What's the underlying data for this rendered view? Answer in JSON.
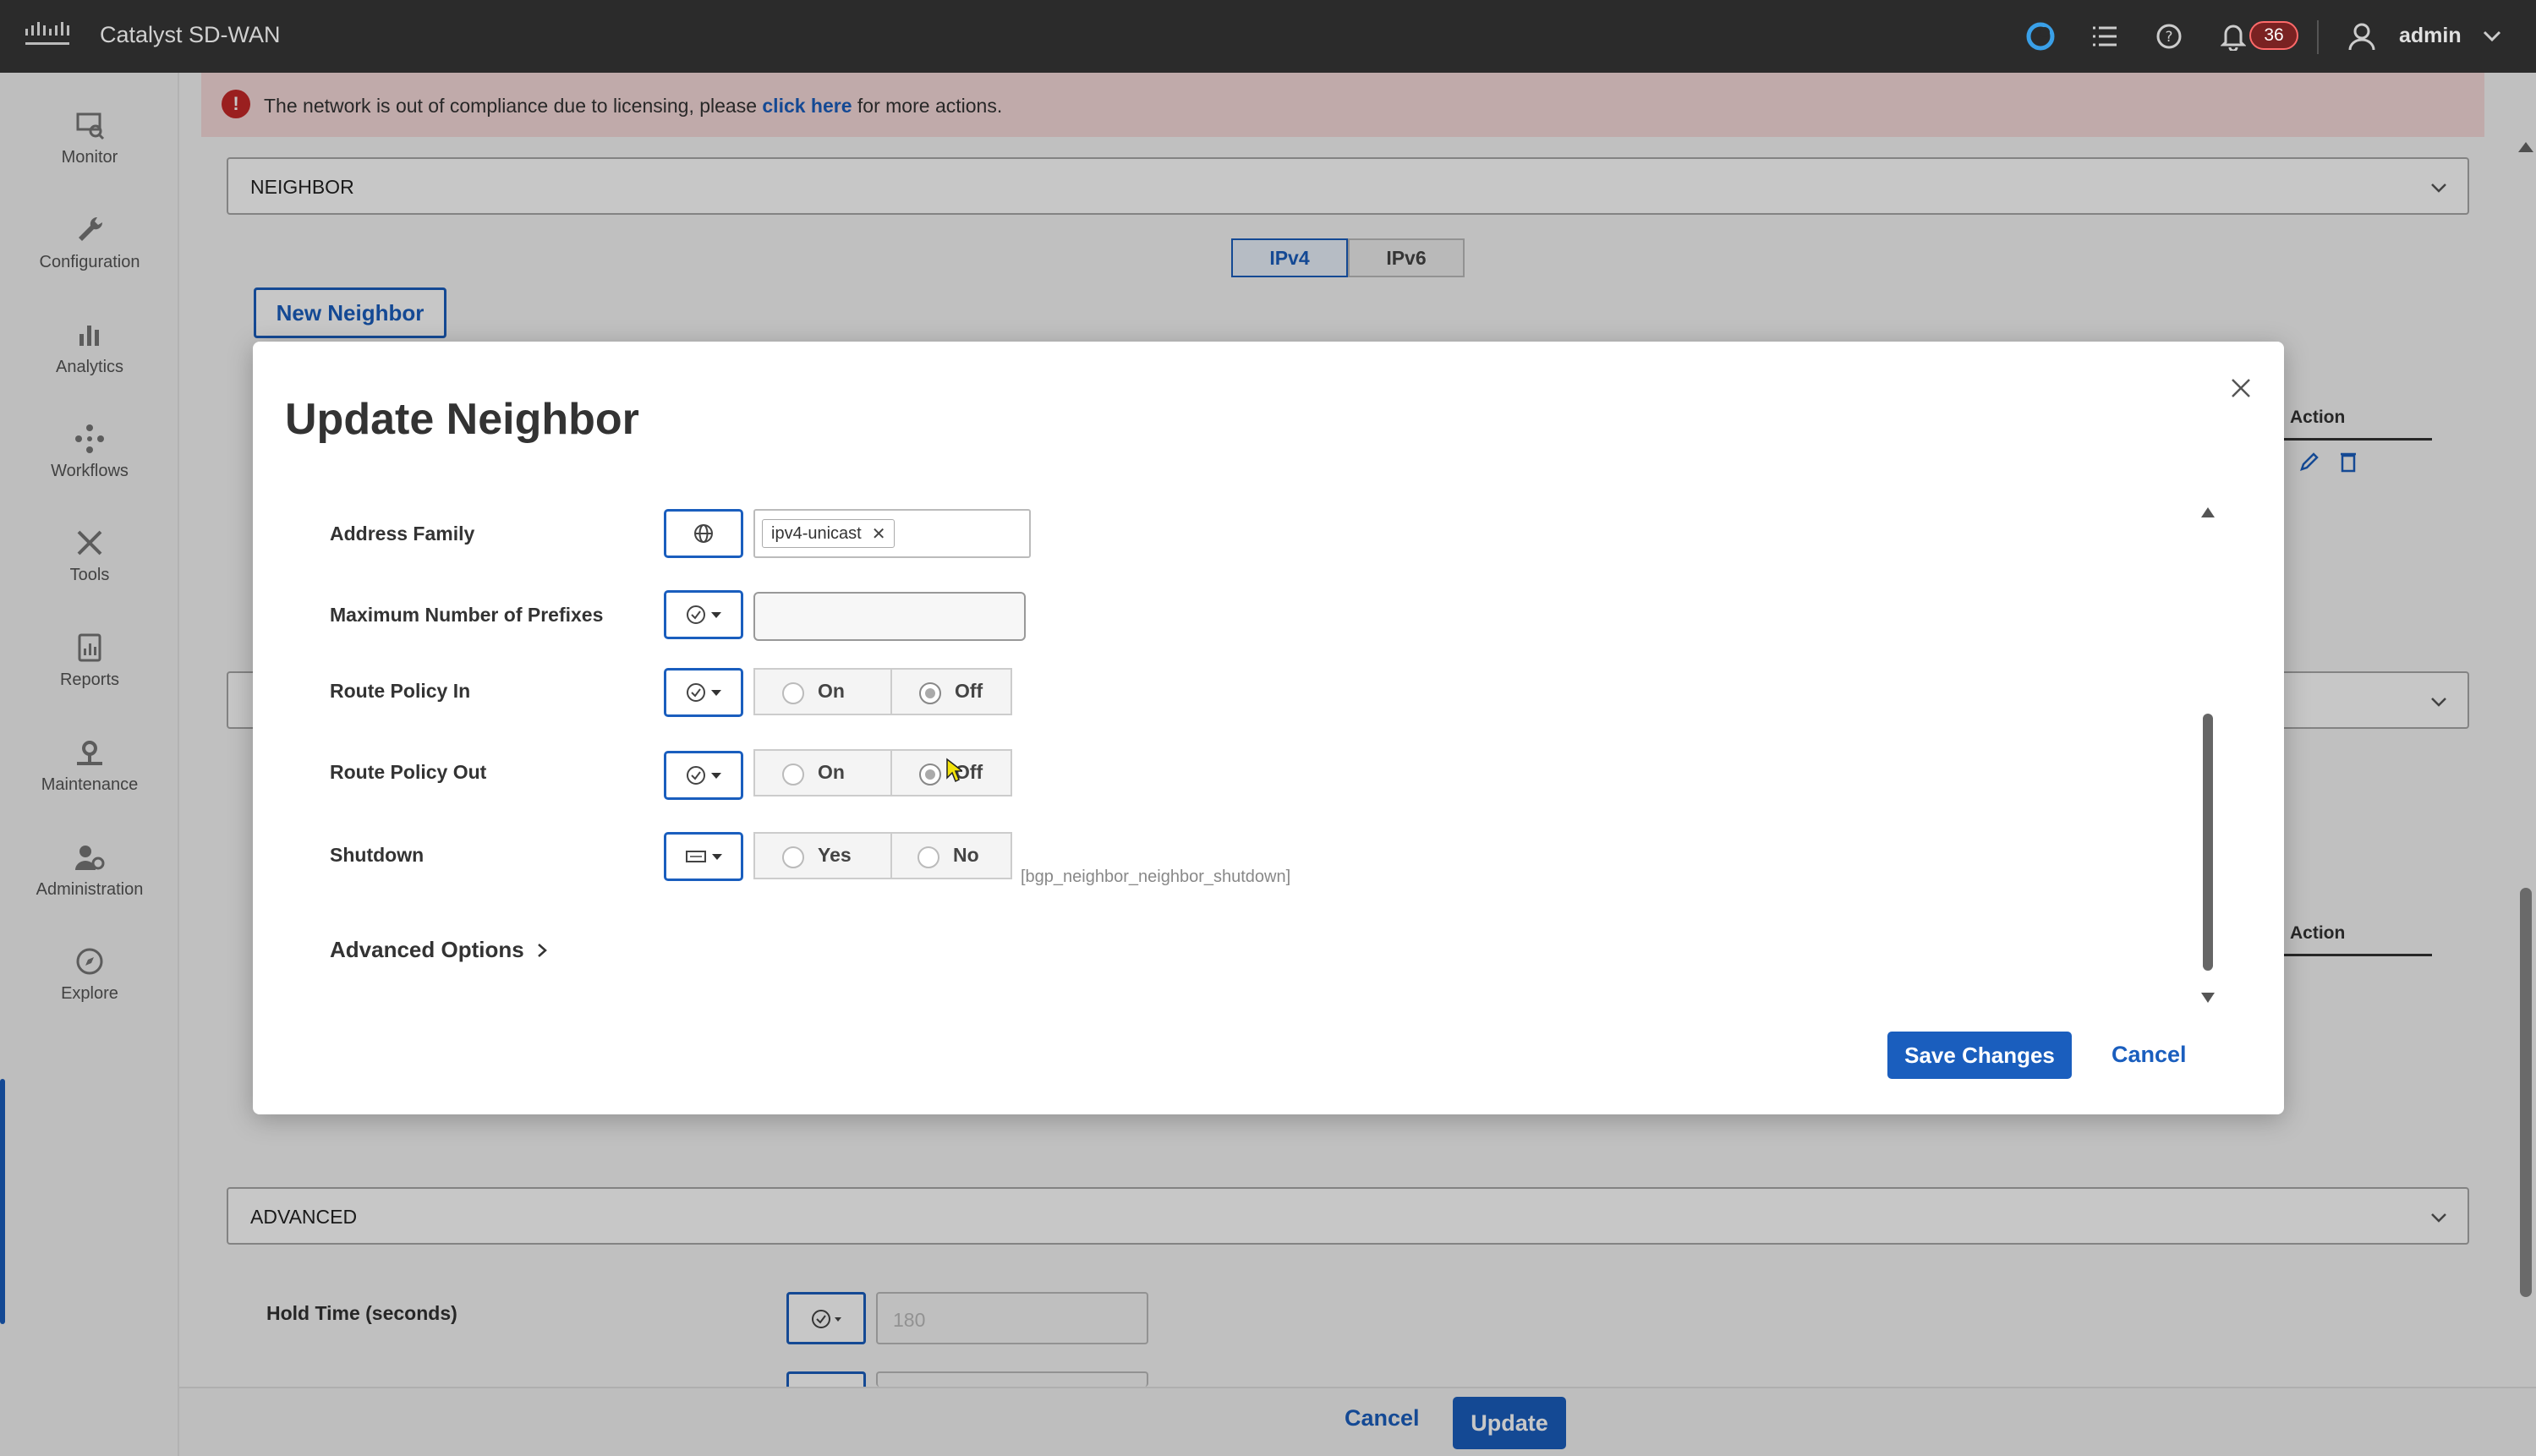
{
  "app": {
    "title": "Catalyst SD-WAN",
    "user": "admin",
    "notification_count": "36"
  },
  "sidebar": {
    "items": [
      {
        "label": "Monitor",
        "icon": "monitor-icon"
      },
      {
        "label": "Configuration",
        "icon": "wrench-icon"
      },
      {
        "label": "Analytics",
        "icon": "bar-chart-icon"
      },
      {
        "label": "Workflows",
        "icon": "workflow-icon"
      },
      {
        "label": "Tools",
        "icon": "tools-icon"
      },
      {
        "label": "Reports",
        "icon": "report-icon"
      },
      {
        "label": "Maintenance",
        "icon": "maintenance-icon"
      },
      {
        "label": "Administration",
        "icon": "admin-icon"
      },
      {
        "label": "Explore",
        "icon": "compass-icon"
      }
    ]
  },
  "banner": {
    "text_before": "The network is out of compliance due to licensing, please ",
    "link": "click here",
    "text_after": " for more actions."
  },
  "page": {
    "neighbor_section": "NEIGHBOR",
    "tabs": [
      "IPv4",
      "IPv6"
    ],
    "active_tab": "IPv4",
    "new_neighbor_label": "New Neighbor",
    "action_header": "Action",
    "action_header_2": "Action",
    "advanced_section": "ADVANCED",
    "hold_time_label": "Hold Time (seconds)",
    "hold_time_placeholder": "180",
    "cancel_label": "Cancel",
    "update_label": "Update"
  },
  "modal": {
    "title": "Update Neighbor",
    "fields": {
      "address_family": {
        "label": "Address Family",
        "tag": "ipv4-unicast"
      },
      "max_prefixes": {
        "label": "Maximum Number of Prefixes",
        "value": ""
      },
      "route_policy_in": {
        "label": "Route Policy In",
        "options": [
          "On",
          "Off"
        ],
        "selected": "Off"
      },
      "route_policy_out": {
        "label": "Route Policy Out",
        "options": [
          "On",
          "Off"
        ],
        "selected": "Off"
      },
      "shutdown": {
        "label": "Shutdown",
        "options": [
          "Yes",
          "No"
        ],
        "selected": "",
        "variable": "[bgp_neighbor_neighbor_shutdown]"
      }
    },
    "advanced_options_label": "Advanced Options",
    "save_label": "Save Changes",
    "cancel_label": "Cancel"
  },
  "colors": {
    "accent": "#1a5ebe",
    "topbar": "#2b2b2b",
    "banner": "#f7dada",
    "error": "#c62828"
  }
}
